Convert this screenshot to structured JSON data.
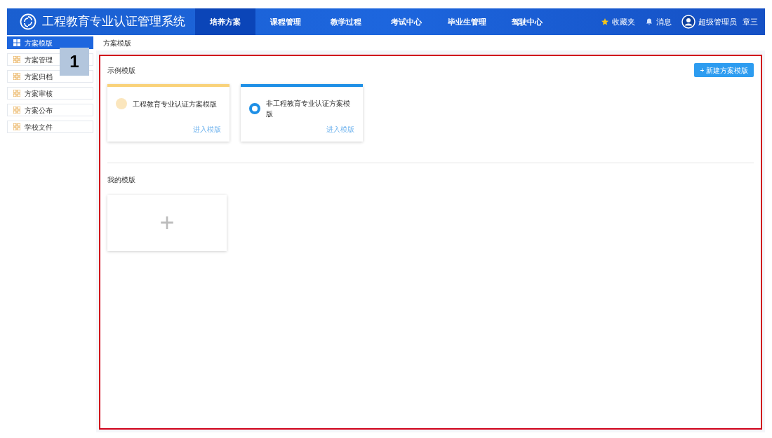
{
  "header": {
    "title": "工程教育专业认证管理系统",
    "nav": [
      {
        "label": "培养方案",
        "selected": true
      },
      {
        "label": "课程管理",
        "selected": false
      },
      {
        "label": "教学过程",
        "selected": false
      },
      {
        "label": "考试中心",
        "selected": false
      },
      {
        "label": "毕业生管理",
        "selected": false
      },
      {
        "label": "驾驶中心",
        "selected": false
      }
    ],
    "favorites": "收藏夹",
    "messages": "消息",
    "role": "超级管理员",
    "user": "章三"
  },
  "sidebar": {
    "items": [
      {
        "label": "方案模版",
        "selected": true
      },
      {
        "label": "方案管理",
        "selected": false
      },
      {
        "label": "方案归档",
        "selected": false
      },
      {
        "label": "方案审核",
        "selected": false
      },
      {
        "label": "方案公布",
        "selected": false
      },
      {
        "label": "学校文件",
        "selected": false
      }
    ]
  },
  "breadcrumb": "方案模版",
  "callout": "1",
  "examples": {
    "title": "示例模版",
    "new_button": "+ 新建方案模版",
    "cards": [
      {
        "title": "工程教育专业认证方案模版",
        "link": "进入模版",
        "color": "#f9d27a"
      },
      {
        "title": "非工程教育专业认证方案模版",
        "link": "进入模版",
        "color": "#1e8fe6"
      }
    ]
  },
  "mine": {
    "title": "我的模版",
    "add": "+"
  }
}
